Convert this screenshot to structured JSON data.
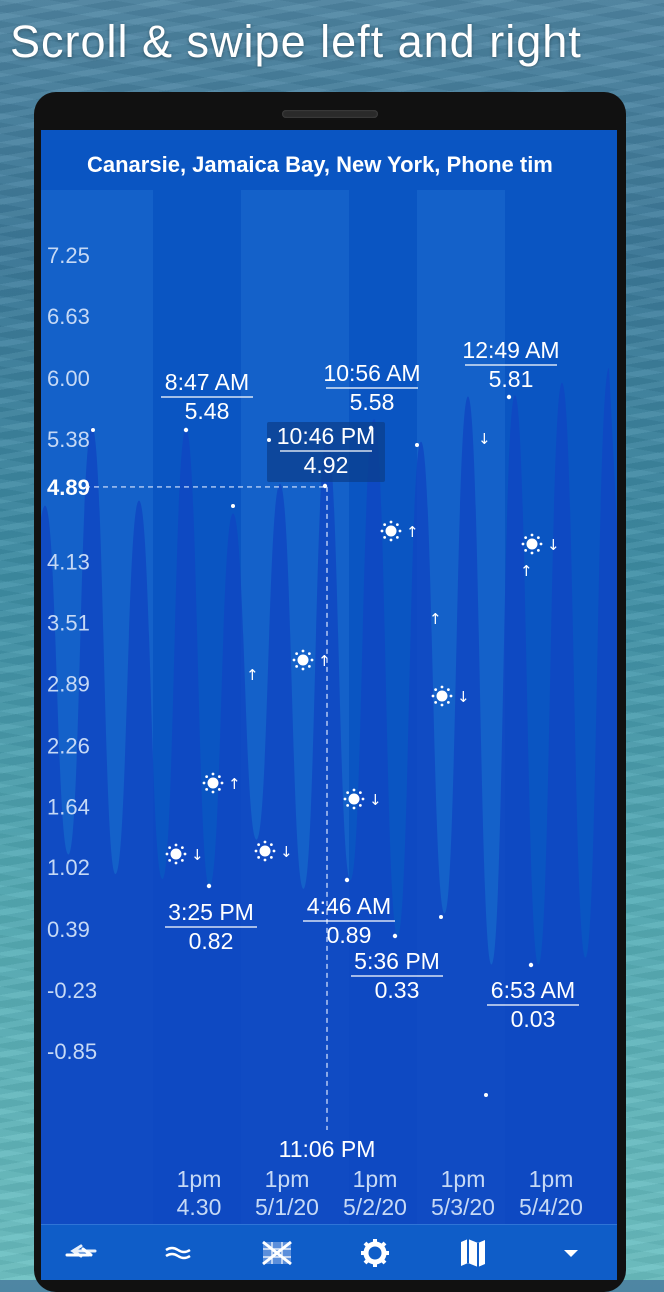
{
  "banner": {
    "text": "Scroll & swipe left and right"
  },
  "header": {
    "title": "Canarsie, Jamaica Bay, New York, Phone tim"
  },
  "chart_data": {
    "type": "line",
    "title": "",
    "y_ticks": [
      "7.25",
      "6.63",
      "6.00",
      "5.38",
      "4.89",
      "4.13",
      "3.51",
      "2.89",
      "2.26",
      "1.64",
      "1.02",
      "0.39",
      "-0.23",
      "-0.85"
    ],
    "ylim": [
      -0.85,
      7.25
    ],
    "cursor": {
      "time": "11:06 PM",
      "value": "4.89"
    },
    "x_ticks": [
      {
        "hour": "1pm",
        "date": "4.30"
      },
      {
        "hour": "1pm",
        "date": "5/1/20"
      },
      {
        "hour": "1pm",
        "date": "5/2/20"
      },
      {
        "hour": "1pm",
        "date": "5/3/20"
      },
      {
        "hour": "1pm",
        "date": "5/4/20"
      }
    ],
    "tides": [
      {
        "type": "high",
        "time": "8:47 AM",
        "height": "5.48"
      },
      {
        "type": "low",
        "time": "3:25 PM",
        "height": "0.82"
      },
      {
        "type": "high",
        "time": "10:46 PM",
        "height": "4.92",
        "highlighted": true
      },
      {
        "type": "low",
        "time": "4:46 AM",
        "height": "0.89"
      },
      {
        "type": "high",
        "time": "10:56 AM",
        "height": "5.58"
      },
      {
        "type": "low",
        "time": "5:36 PM",
        "height": "0.33"
      },
      {
        "type": "high",
        "time": "12:49 AM",
        "height": "5.81"
      },
      {
        "type": "low",
        "time": "6:53 AM",
        "height": "0.03"
      }
    ],
    "series_peaks": [
      4.7,
      1.15,
      5.5,
      0.95,
      4.75,
      0.9,
      5.48,
      0.82,
      4.62,
      1.3,
      4.92,
      0.8,
      5.4,
      0.89,
      5.58,
      0.32,
      5.35,
      0.55,
      5.81,
      0.03,
      5.82,
      0.03,
      5.95,
      0.1,
      6.1
    ]
  },
  "astro_markers": [
    {
      "icon": "sun-set-icon",
      "arrow": "↓"
    },
    {
      "icon": "sun-rise-icon",
      "arrow": "↑"
    },
    {
      "icon": "moon-rise-icon",
      "arrow": "↑"
    },
    {
      "icon": "sun-set-icon",
      "arrow": "↓"
    },
    {
      "icon": "sun-set-icon",
      "arrow": "↑"
    },
    {
      "icon": "sun-set-icon",
      "arrow": "↓"
    },
    {
      "icon": "sun-rise-icon",
      "arrow": "↑"
    },
    {
      "icon": "moon-rise-icon",
      "arrow": "↑"
    },
    {
      "icon": "sun-set-icon",
      "arrow": "↓"
    },
    {
      "icon": "moon-set-icon",
      "arrow": "↓"
    },
    {
      "icon": "moon-rise-icon",
      "arrow": "↑"
    },
    {
      "icon": "sun-set-icon",
      "arrow": "↓"
    }
  ],
  "bottom_nav": [
    {
      "name": "swap-icon"
    },
    {
      "name": "waves-icon"
    },
    {
      "name": "grid-icon"
    },
    {
      "name": "gear-icon"
    },
    {
      "name": "map-icon"
    },
    {
      "name": "dropdown-icon"
    }
  ],
  "colors": {
    "background": "#0a55c2",
    "fill": "#0f48c2",
    "band_light": "#1d6bd0",
    "text": "#ffffff",
    "tick": "#c6d9f5"
  }
}
